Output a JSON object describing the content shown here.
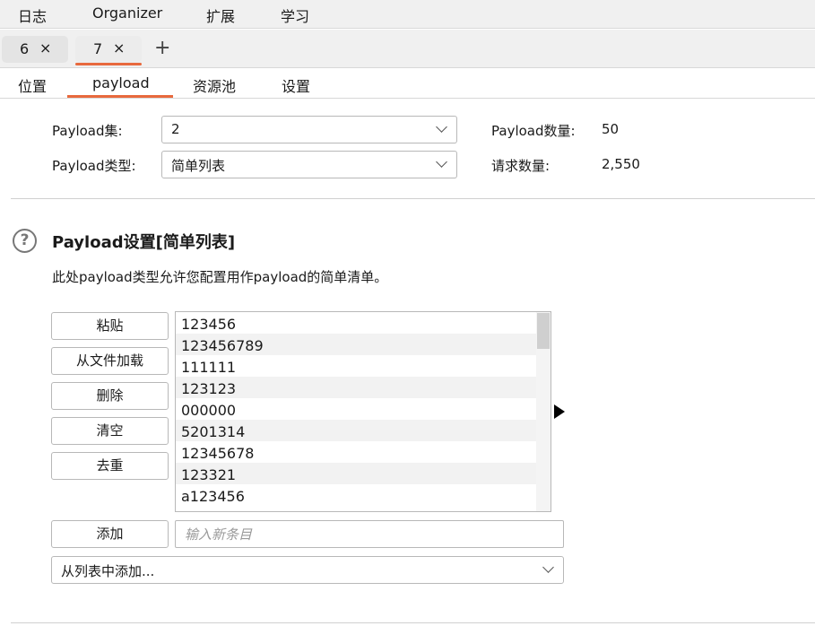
{
  "menu": [
    "日志",
    "Organizer",
    "扩展",
    "学习"
  ],
  "request_tabs": [
    {
      "label": "6",
      "close": "×"
    },
    {
      "label": "7",
      "close": "×"
    }
  ],
  "add_tab_symbol": "+",
  "subtabs": [
    "位置",
    "payload",
    "资源池",
    "设置"
  ],
  "payload_form": {
    "set_label": "Payload集:",
    "set_value": "2",
    "type_label": "Payload类型:",
    "type_value": "简单列表",
    "count_label": "Payload数量:",
    "count_value": "50",
    "request_label": "请求数量:",
    "request_value": "2,550"
  },
  "settings_section": {
    "help_symbol": "?",
    "title": "Payload设置[简单列表]",
    "description": "此处payload类型允许您配置用作payload的简单清单。"
  },
  "buttons": [
    "粘贴",
    "从文件加载",
    "删除",
    "清空",
    "去重"
  ],
  "payload_list": [
    "123456",
    "123456789",
    "111111",
    "123123",
    "000000",
    "5201314",
    "12345678",
    "123321",
    "a123456"
  ],
  "add_button": "添加",
  "new_item_placeholder": "输入新条目",
  "add_from_list": "从列表中添加..."
}
